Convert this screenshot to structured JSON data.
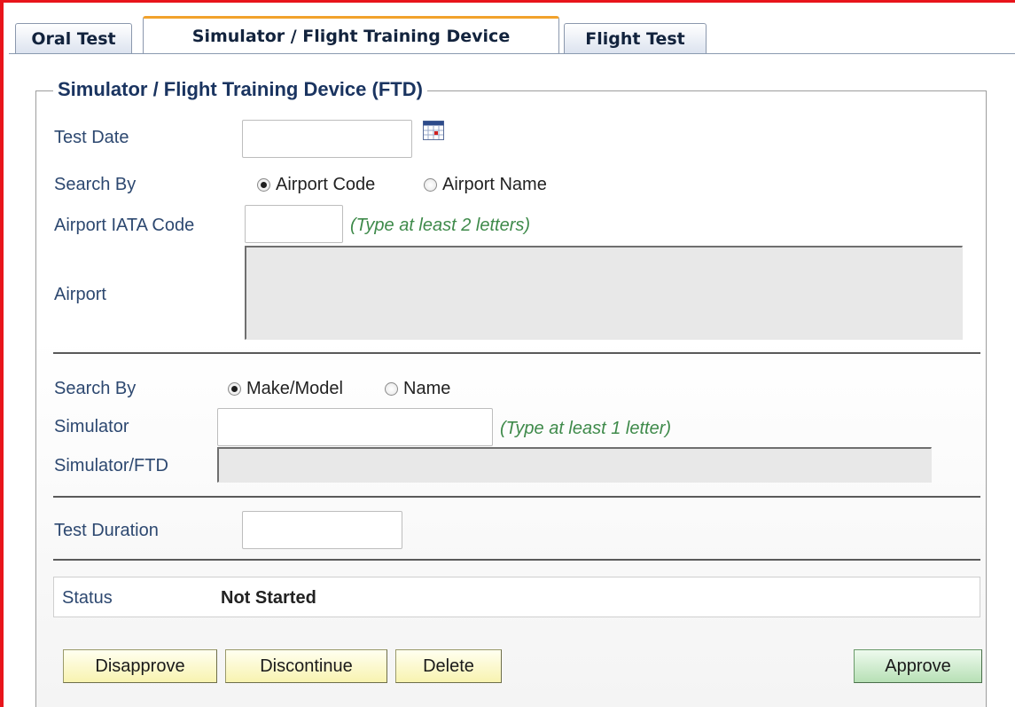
{
  "tabs": {
    "oral": "Oral Test",
    "simulator": "Simulator / Flight Training Device",
    "flight": "Flight Test",
    "active": "simulator"
  },
  "section": {
    "legend": "Simulator / Flight Training Device (FTD)"
  },
  "test_date": {
    "label": "Test Date",
    "value": ""
  },
  "airport_search": {
    "label": "Search By",
    "options": [
      "Airport Code",
      "Airport Name"
    ],
    "selected": "Airport Code"
  },
  "iata": {
    "label": "Airport IATA Code",
    "value": "",
    "hint": "(Type at least 2 letters)"
  },
  "airport": {
    "label": "Airport",
    "value": ""
  },
  "sim_search": {
    "label": "Search By",
    "options": [
      "Make/Model",
      "Name"
    ],
    "selected": "Make/Model"
  },
  "simulator": {
    "label": "Simulator",
    "value": "",
    "hint": "(Type at least 1 letter)"
  },
  "simulator_ftd": {
    "label": "Simulator/FTD",
    "value": ""
  },
  "duration": {
    "label": "Test Duration",
    "value": ""
  },
  "status": {
    "label": "Status",
    "value": "Not Started"
  },
  "buttons": {
    "disapprove": "Disapprove",
    "discontinue": "Discontinue",
    "delete": "Delete",
    "approve": "Approve"
  },
  "colors": {
    "frame": "#e8141b",
    "active_tab_accent": "#f2a22c",
    "legend": "#1a3460",
    "label": "#2d4870",
    "hint": "#3e8a4a",
    "button_yellow": "#f8f3b0",
    "button_green": "#b7e0b5"
  },
  "icons": {
    "calendar": "calendar-icon"
  }
}
